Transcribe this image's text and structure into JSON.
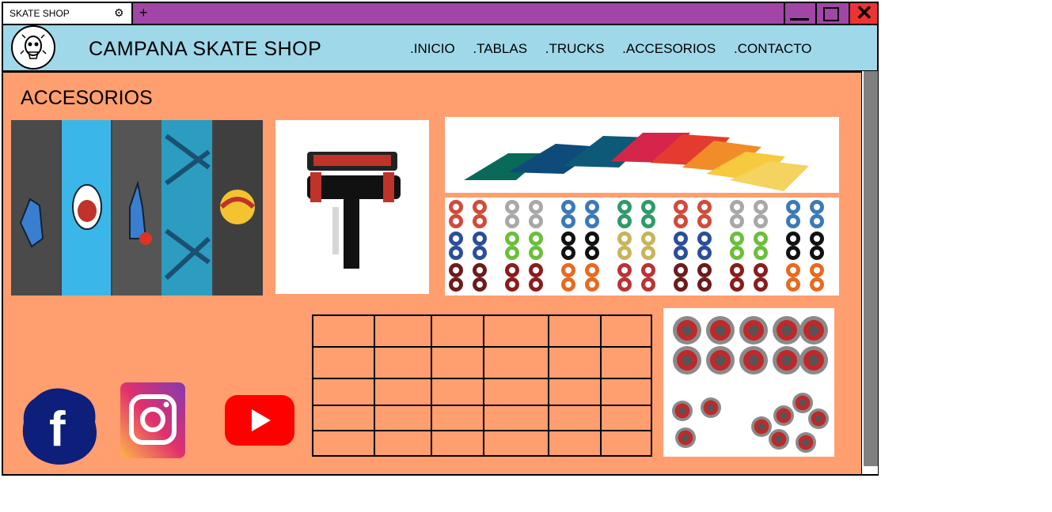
{
  "window": {
    "tab_title": "SKATE SHOP",
    "new_tab_symbol": "+",
    "colors": {
      "titlebar": "#a146a6",
      "header": "#9fd8e9",
      "content": "#ff9e6e",
      "close": "#ee3333"
    }
  },
  "header": {
    "title": "CAMPANA SKATE SHOP",
    "nav": [
      ".INICIO",
      ".TABLAS",
      ".TRUCKS",
      ".ACCESORIOS",
      ".CONTACTO"
    ]
  },
  "main": {
    "section_title": "ACCESORIOS",
    "products": [
      {
        "icon": "griptape-image"
      },
      {
        "icon": "skate-tool-image"
      },
      {
        "icon": "riser-pads-image"
      },
      {
        "icon": "wheels-image"
      },
      {
        "icon": "bearings-image"
      }
    ],
    "social": [
      "facebook-icon",
      "instagram-icon",
      "youtube-icon"
    ]
  }
}
